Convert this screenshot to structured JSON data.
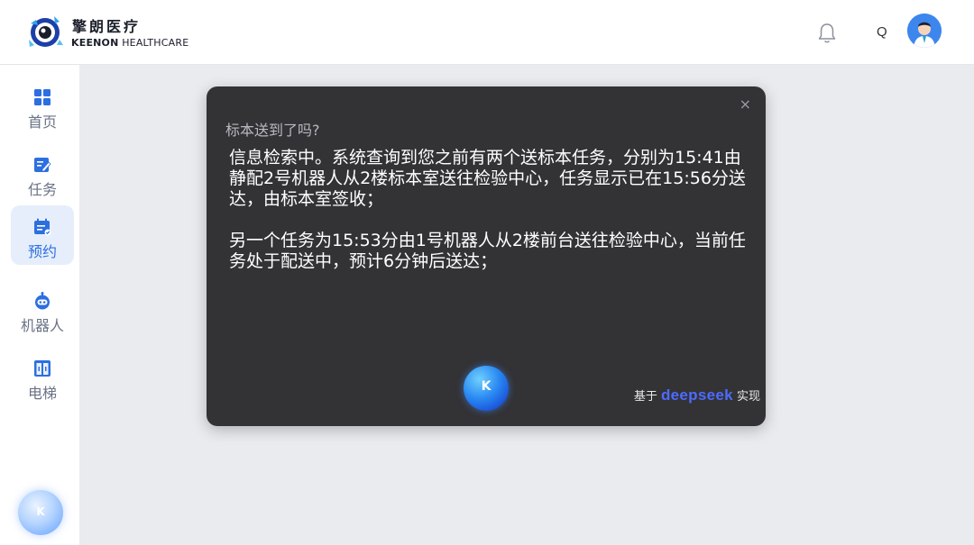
{
  "header": {
    "brand_cn": "擎朗医疗",
    "brand_en_bold": "KEENON",
    "brand_en_rest": " HEALTHCARE",
    "lang_label": "Q",
    "icons": {
      "logo": "keenon-logo",
      "bell": "bell-icon",
      "avatar": "doctor-avatar"
    }
  },
  "sidebar": {
    "items": [
      {
        "label": "首页",
        "icon": "grid-icon",
        "active": false
      },
      {
        "label": "任务",
        "icon": "edit-task-icon",
        "active": false
      },
      {
        "label": "预约",
        "icon": "calendar-icon",
        "active": true
      },
      {
        "label": "机器人",
        "icon": "robot-icon",
        "active": false
      },
      {
        "label": "电梯",
        "icon": "elevator-icon",
        "active": false
      }
    ],
    "assistant_letter": "K"
  },
  "modal": {
    "close_symbol": "×",
    "question": "标本送到了吗?",
    "answer_p1": "信息检索中。系统查询到您之前有两个送标本任务，分别为15:41由静配2号机器人从2楼标本室送往检验中心，任务显示已在15:56分送达，由标本室签收；",
    "answer_p2": "另一个任务为15:53分由1号机器人从2楼前台送往检验中心，当前任务处于配送中，预计6分钟后送达；",
    "orb_letter": "K",
    "powered_prefix": "基于 ",
    "powered_brand": "deepseek",
    "powered_suffix": " 实现"
  },
  "colors": {
    "accent": "#2c6fe0",
    "modal_bg": "#333336",
    "deepseek_blue": "#4d6bfe",
    "page_bg": "#e9ebef"
  }
}
